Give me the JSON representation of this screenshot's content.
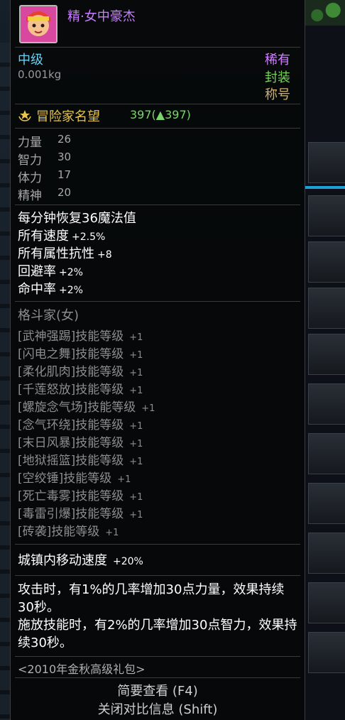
{
  "item": {
    "title": "精·女中豪杰",
    "grade": "中级",
    "weight": "0.001kg",
    "rarity": "稀有",
    "sealed": "封装",
    "type": "称号",
    "reputation_label": "冒险家名望",
    "reputation_value": "397(▲397)",
    "stats": [
      {
        "name": "力量",
        "value": "26"
      },
      {
        "name": "智力",
        "value": "30"
      },
      {
        "name": "体力",
        "value": "17"
      },
      {
        "name": "精神",
        "value": "20"
      }
    ],
    "effects": [
      {
        "name": "每分钟恢复36魔法值",
        "value": ""
      },
      {
        "name": "所有速度",
        "value": "+2.5%"
      },
      {
        "name": "所有属性抗性",
        "value": "+8"
      },
      {
        "name": "回避率",
        "value": "+2%"
      },
      {
        "name": "命中率",
        "value": "+2%"
      }
    ],
    "class_name": "格斗家(女)",
    "skills": [
      {
        "name": "[武神强踢]技能等级",
        "value": "+1"
      },
      {
        "name": "[闪电之舞]技能等级",
        "value": "+1"
      },
      {
        "name": "[柔化肌肉]技能等级",
        "value": "+1"
      },
      {
        "name": "[千莲怒放]技能等级",
        "value": "+1"
      },
      {
        "name": "[螺旋念气场]技能等级",
        "value": "+1"
      },
      {
        "name": "[念气环绕]技能等级",
        "value": "+1"
      },
      {
        "name": "[末日风暴]技能等级",
        "value": "+1"
      },
      {
        "name": "[地狱摇篮]技能等级",
        "value": "+1"
      },
      {
        "name": "[空绞锤]技能等级",
        "value": "+1"
      },
      {
        "name": "[死亡毒雾]技能等级",
        "value": "+1"
      },
      {
        "name": "[毒雷引爆]技能等级",
        "value": "+1"
      },
      {
        "name": "[砖袭]技能等级",
        "value": "+1"
      }
    ],
    "town_speed_label": "城镇内移动速度",
    "town_speed_value": "+20%",
    "proc_text_1": "攻击时，有1%的几率增加30点力量，效果持续30秒。",
    "proc_text_2": "施放技能时，有2%的几率增加30点智力，效果持续30秒。",
    "source": "<2010年金秋高级礼包>"
  },
  "hints": {
    "brief_view": "简要查看 (F4)",
    "close_compare": "关闭对比信息 (Shift)"
  },
  "colors": {
    "title": "#c97dff",
    "rarity": "#d080ff",
    "sealed": "#79d15a",
    "reputation": "#e9c44b"
  },
  "icons": {
    "item_icon": "title-portrait-icon",
    "reputation_icon": "laurel-icon"
  }
}
